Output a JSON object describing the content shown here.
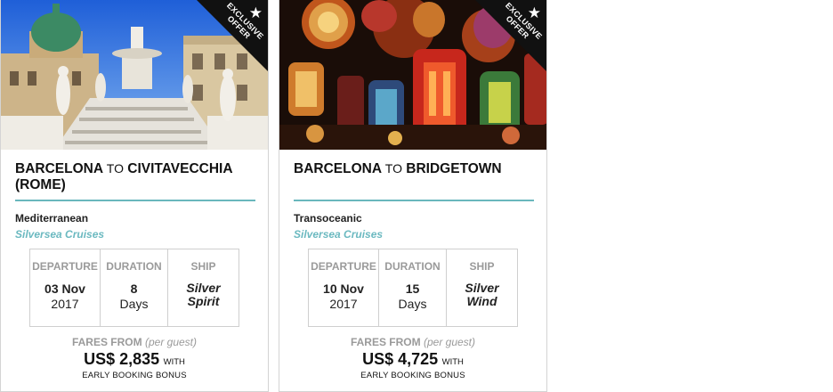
{
  "cards": [
    {
      "badge": "EXCLUSIVE OFFER",
      "origin": "BARCELONA",
      "to": "TO",
      "destination": "CIVITAVECCHIA (ROME)",
      "region": "Mediterranean",
      "cruise_line": "Silversea Cruises",
      "headers": {
        "departure": "DEPARTURE",
        "duration": "DURATION",
        "ship": "SHIP"
      },
      "departure_day": "03 Nov",
      "departure_year": "2017",
      "duration_num": "8",
      "duration_unit": "Days",
      "ship_line1": "Silver",
      "ship_line2": "Spirit",
      "fares_label": "FARES FROM",
      "per_guest": "(per guest)",
      "price": "US$ 2,835",
      "with": "WITH",
      "bonus": "EARLY BOOKING BONUS",
      "image_icon": "palermo-fountain-photo"
    },
    {
      "badge": "EXCLUSIVE OFFER",
      "origin": "BARCELONA",
      "to": "TO",
      "destination": "BRIDGETOWN",
      "region": "Transoceanic",
      "cruise_line": "Silversea Cruises",
      "headers": {
        "departure": "DEPARTURE",
        "duration": "DURATION",
        "ship": "SHIP"
      },
      "departure_day": "10 Nov",
      "departure_year": "2017",
      "duration_num": "15",
      "duration_unit": "Days",
      "ship_line1": "Silver",
      "ship_line2": "Wind",
      "fares_label": "FARES FROM",
      "per_guest": "(per guest)",
      "price": "US$ 4,725",
      "with": "WITH",
      "bonus": "EARLY BOOKING BONUS",
      "image_icon": "moroccan-lanterns-photo"
    }
  ],
  "colors": {
    "accent": "#69b7bd",
    "muted": "#9a9a9a",
    "ribbon": "#111111"
  }
}
